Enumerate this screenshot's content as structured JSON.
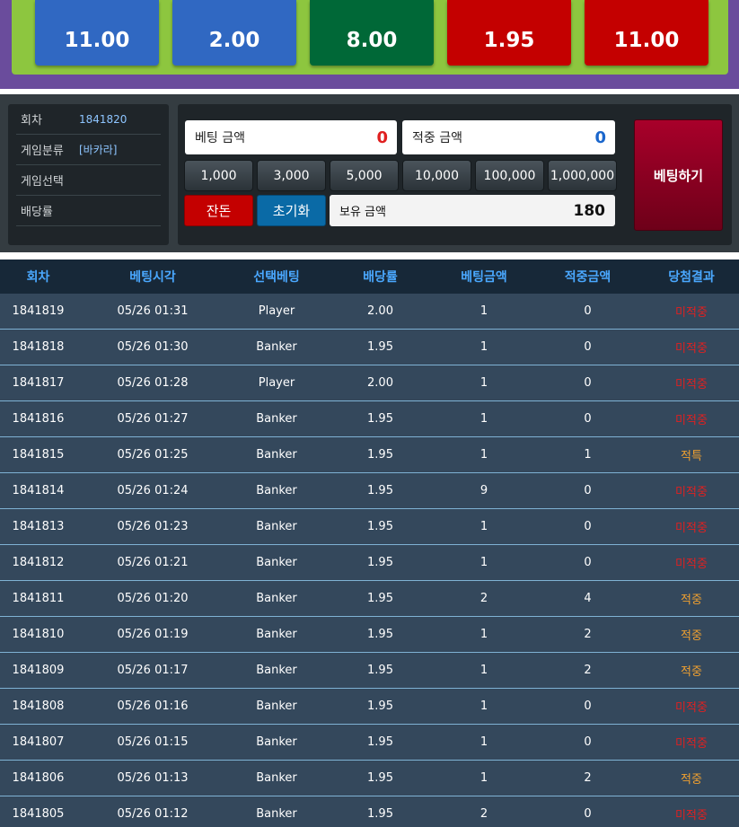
{
  "odds": [
    {
      "value": "11.00",
      "color": "#3068c2"
    },
    {
      "value": "2.00",
      "color": "#3068c2"
    },
    {
      "value": "8.00",
      "color": "#006837"
    },
    {
      "value": "1.95",
      "color": "#c40000"
    },
    {
      "value": "11.00",
      "color": "#c40000"
    }
  ],
  "info": {
    "round_label": "회차",
    "round_value": "1841820",
    "game_type_label": "게임분류",
    "game_type_value": "[바카라]",
    "game_select_label": "게임선택",
    "game_select_value": "",
    "odds_label": "배당률",
    "odds_value": ""
  },
  "bet": {
    "bet_amount_label": "베팅 금액",
    "bet_amount_value": "0",
    "win_amount_label": "적중 금액",
    "win_amount_value": "0",
    "chips": [
      "1,000",
      "3,000",
      "5,000",
      "10,000",
      "100,000",
      "1,000,000"
    ],
    "change_label": "잔돈",
    "reset_label": "초기화",
    "holding_label": "보유 금액",
    "holding_value": "180",
    "submit_label": "베팅하기"
  },
  "history": {
    "headers": [
      "회차",
      "베팅시각",
      "선택베팅",
      "배당률",
      "베팅금액",
      "적중금액",
      "당첨결과"
    ],
    "rows": [
      [
        "1841819",
        "05/26 01:31",
        "Player",
        "2.00",
        "1",
        "0",
        "미적중"
      ],
      [
        "1841818",
        "05/26 01:30",
        "Banker",
        "1.95",
        "1",
        "0",
        "미적중"
      ],
      [
        "1841817",
        "05/26 01:28",
        "Player",
        "2.00",
        "1",
        "0",
        "미적중"
      ],
      [
        "1841816",
        "05/26 01:27",
        "Banker",
        "1.95",
        "1",
        "0",
        "미적중"
      ],
      [
        "1841815",
        "05/26 01:25",
        "Banker",
        "1.95",
        "1",
        "1",
        "적특"
      ],
      [
        "1841814",
        "05/26 01:24",
        "Banker",
        "1.95",
        "9",
        "0",
        "미적중"
      ],
      [
        "1841813",
        "05/26 01:23",
        "Banker",
        "1.95",
        "1",
        "0",
        "미적중"
      ],
      [
        "1841812",
        "05/26 01:21",
        "Banker",
        "1.95",
        "1",
        "0",
        "미적중"
      ],
      [
        "1841811",
        "05/26 01:20",
        "Banker",
        "1.95",
        "2",
        "4",
        "적중"
      ],
      [
        "1841810",
        "05/26 01:19",
        "Banker",
        "1.95",
        "1",
        "2",
        "적중"
      ],
      [
        "1841809",
        "05/26 01:17",
        "Banker",
        "1.95",
        "1",
        "2",
        "적중"
      ],
      [
        "1841808",
        "05/26 01:16",
        "Banker",
        "1.95",
        "1",
        "0",
        "미적중"
      ],
      [
        "1841807",
        "05/26 01:15",
        "Banker",
        "1.95",
        "1",
        "0",
        "미적중"
      ],
      [
        "1841806",
        "05/26 01:13",
        "Banker",
        "1.95",
        "1",
        "2",
        "적중"
      ],
      [
        "1841805",
        "05/26 01:12",
        "Banker",
        "1.95",
        "2",
        "0",
        "미적중"
      ]
    ],
    "colors": {
      "lose": "#e02020",
      "win": "#f0a030"
    }
  }
}
